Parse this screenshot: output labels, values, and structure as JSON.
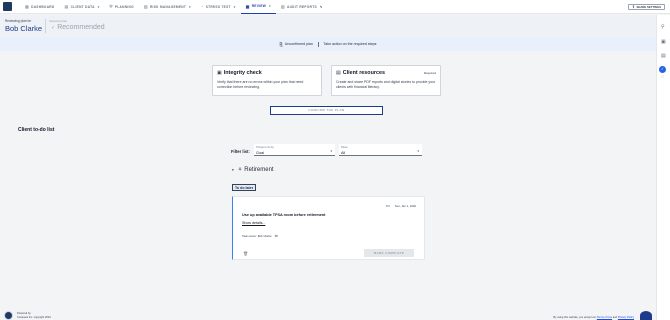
{
  "nav": {
    "tabs": [
      {
        "label": "Dashboard",
        "icon": "grid-icon",
        "glyph": "▦",
        "caret": ""
      },
      {
        "label": "Client data",
        "icon": "document-icon",
        "glyph": "▤",
        "caret": "▾"
      },
      {
        "label": "Planning",
        "icon": "lock-icon",
        "glyph": "⛨",
        "caret": ""
      },
      {
        "label": "Risk management",
        "icon": "shield-icon",
        "glyph": "▥",
        "caret": "▾"
      },
      {
        "label": "Stress test",
        "icon": "gauge-icon",
        "glyph": "◔",
        "caret": "▾"
      },
      {
        "label": "Review",
        "icon": "checklist-icon",
        "glyph": "▦",
        "caret": "▾"
      },
      {
        "label": "Audit reports",
        "icon": "chart-icon",
        "glyph": "▥",
        "caret": "✎"
      }
    ],
    "active_index": 5,
    "share_label": "Share settings"
  },
  "header": {
    "reviewing_label": "Reviewing plan for",
    "client_name": "Bob Clarke",
    "selector_label": "Selected plan",
    "selector_value": "Recommended"
  },
  "banner": {
    "status": "Unconfirmed plan",
    "action": "Take action on the required steps"
  },
  "cards": {
    "integrity": {
      "title": "Integrity check",
      "description": "Verify that there are no errors within your plan that need correction before reviewing."
    },
    "resources": {
      "title": "Client resources",
      "badge": "Required",
      "description": "Create and share PDF reports and digital stories to provide your clients with financial literacy."
    }
  },
  "confirm_button": "Confirm the plan",
  "todo": {
    "title": "Client to-do list",
    "filter_label": "Filter list:",
    "filter_goal": {
      "label": "Things to do by",
      "value": "Goal"
    },
    "filter_show": {
      "label": "Show",
      "value": "All"
    },
    "group": "Retirement",
    "section": "To do later",
    "task": {
      "date": "Sun, Jan 1, 2040",
      "title": "Use up available TFSA room before retirement",
      "details": "Show details...",
      "owner": "Task owner: Bob Clarke",
      "action": "Mark complete"
    }
  },
  "footer": {
    "powered": "Powered by",
    "copyright": "Conquest Inc. copyright 2024",
    "consent_prefix": "By using this website, you accept our",
    "terms": "Terms of Use",
    "and": "and",
    "privacy": "Privacy Policy"
  }
}
